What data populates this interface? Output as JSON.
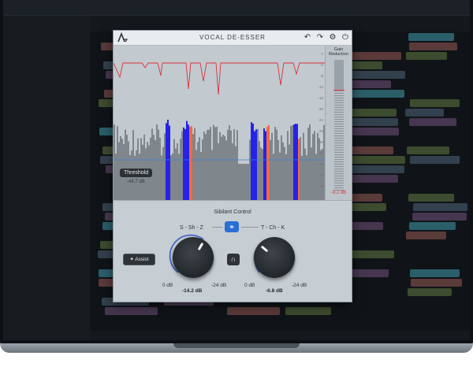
{
  "plugin": {
    "title": "VOCAL DE-ESSER",
    "toolbar": {
      "undo_icon": "undo-icon",
      "redo_icon": "redo-icon",
      "settings_icon": "gear-icon",
      "power_icon": "power-icon"
    }
  },
  "analyzer": {
    "db_scale": [
      "0",
      "-4",
      "-8",
      "-12",
      "-16",
      "-20",
      "-24",
      "-28",
      "-32",
      "-36",
      "-40",
      "-44",
      "-48"
    ],
    "threshold": {
      "label": "Threshold",
      "value": "-44.7 dB"
    }
  },
  "gain_reduction": {
    "title_line1": "Gain",
    "title_line2": "Reduction",
    "value": "-9.2 dB",
    "level_db": -9.2
  },
  "controls": {
    "section_title": "Sibilant Control",
    "band_left_label": "S - Sh - Z",
    "band_right_label": "T - Ch - K",
    "link_icon": "link-icon",
    "assist_label": "Assist",
    "assist_icon": "magic-wand-icon",
    "listen_icon": "headphones-icon",
    "knob_left": {
      "min": "0 dB",
      "max": "-24 dB",
      "value": "-14.2 dB"
    },
    "knob_right": {
      "min": "0 dB",
      "max": "-24 dB",
      "value": "-6.8 dB"
    }
  },
  "colors": {
    "accent_blue": "#2b6fd3",
    "spectrum_gray": "#7f868c",
    "sibilant_blue": "#2622e6",
    "sibilant_orange": "#f26a3b",
    "gain_curve_red": "#d9343d"
  }
}
